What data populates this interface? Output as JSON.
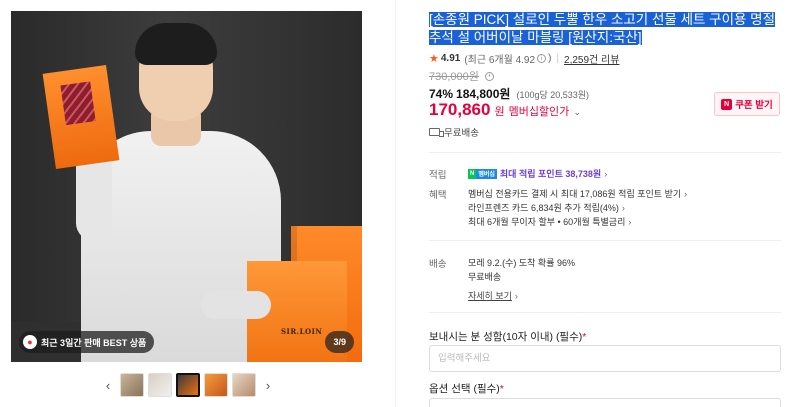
{
  "gallery": {
    "badge_text": "최근 3일간 판매 BEST 상품",
    "counter": "3/9",
    "box_label": "SIR.LOIN",
    "prev_icon": "chevron-left",
    "next_icon": "chevron-right"
  },
  "product": {
    "title": "[손종원 PICK] 설로인 두뿔 한우 소고기 선물 세트 구이용 명절 추석 설 어버이날 마블링 [원산지:국산]",
    "rating": "4.91",
    "rating_sub": "(최근 6개월 4.92",
    "rating_sub_end": ")",
    "review_count": "2,259건 리뷰",
    "original_price": "730,000원",
    "discount": "74%",
    "sale_price": "184,800원",
    "unit_price": "(100g당 20,533원)",
    "member_price": "170,860",
    "member_price_unit": "원",
    "member_label": "멤버십할인가",
    "coupon_button": "쿠폰 받기",
    "shipping": "무료배송"
  },
  "benefits": {
    "points_label": "적립",
    "npay_n": "N",
    "npay_p": "멤버십",
    "points_text": "최대 적립 포인트 38,738원",
    "benefit_label": "혜택",
    "benefit_lines": [
      "멤버십 전용카드 결제 시 최대 17,086원 적립 포인트 받기",
      "라인프렌즈 카드 6,834원 추가 적립(4%)",
      "최대 6개월 무이자 할부 • 60개월 특별금리"
    ]
  },
  "delivery": {
    "label": "배송",
    "arrival": "모레 9.2.(수) 도착 확률 96%",
    "fee": "무료배송",
    "detail_link": "자세히 보기"
  },
  "order_form": {
    "sender_label": "보내시는 분 성함(10자 이내) (필수)",
    "required_mark": "*",
    "sender_placeholder": "입력해주세요",
    "option_label": "옵션 선택 (필수)"
  },
  "colors": {
    "accent_red": "#e5003d",
    "selection_blue": "#1a61d6",
    "star_orange": "#ff5a1f",
    "points_purple": "#6b3fd4"
  }
}
